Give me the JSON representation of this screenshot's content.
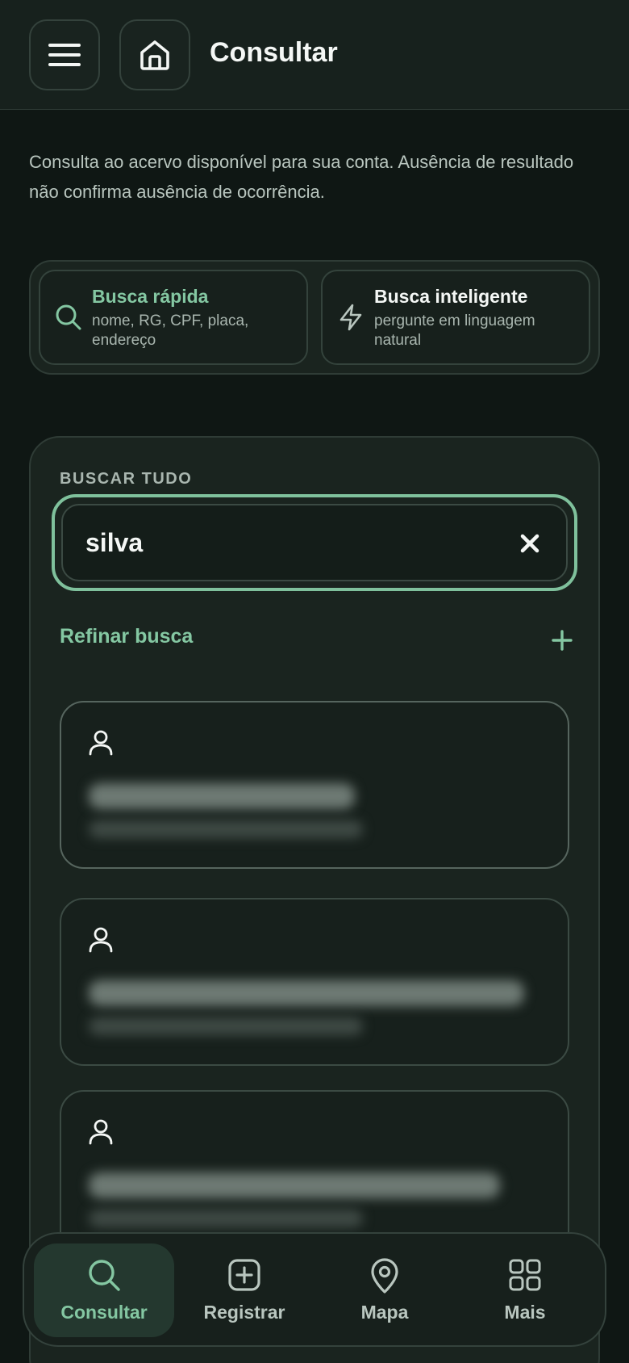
{
  "header": {
    "title": "Consultar",
    "menu_icon": "menu-icon",
    "home_icon": "home-icon"
  },
  "notice": "Consulta ao acervo disponível para sua conta. Ausência de resultado não confirma ausência de ocorrência.",
  "modes": [
    {
      "title": "Busca rápida",
      "subtitle": "nome, RG, CPF, placa, endereço",
      "icon": "search-icon",
      "selected": true
    },
    {
      "title": "Busca inteligente",
      "subtitle": "pergunte em linguagem natural",
      "icon": "lightning-icon",
      "selected": false
    }
  ],
  "search": {
    "label": "BUSCAR TUDO",
    "value": "silva",
    "clear_icon": "close-icon"
  },
  "refine": {
    "label": "Refinar busca",
    "icon": "plus-icon"
  },
  "results": [
    {
      "icon": "person-icon",
      "redacted": true
    },
    {
      "icon": "person-icon",
      "redacted": true
    },
    {
      "icon": "person-icon",
      "redacted": true
    }
  ],
  "tabs": [
    {
      "label": "Consultar",
      "icon": "search-icon",
      "active": true
    },
    {
      "label": "Registrar",
      "icon": "plus-square-icon",
      "active": false
    },
    {
      "label": "Mapa",
      "icon": "map-pin-icon",
      "active": false
    },
    {
      "label": "Mais",
      "icon": "grid-icon",
      "active": false
    }
  ],
  "colors": {
    "background": "#0f1714",
    "surface": "#1a241f",
    "accent": "#84c7a2",
    "focus_ring": "#7fc19c",
    "text": "#f4f7f5",
    "muted_text": "#b9c6bf"
  }
}
